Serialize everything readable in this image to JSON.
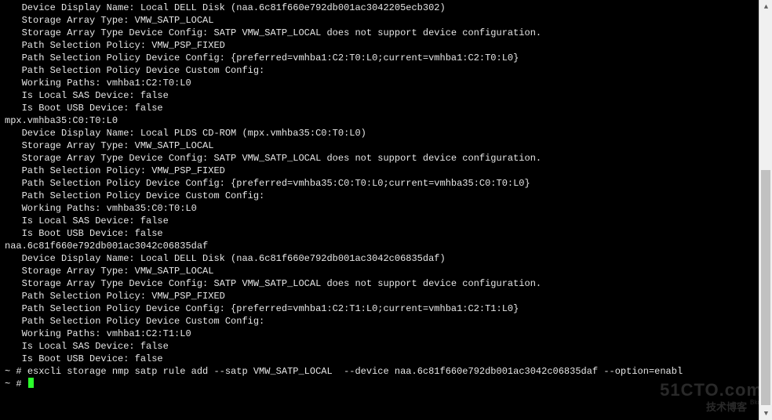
{
  "blocks": [
    {
      "header": null,
      "fields": [
        {
          "label": "Device Display Name",
          "value": "Local DELL Disk (naa.6c81f660e792db001ac3042205ecb302)"
        },
        {
          "label": "Storage Array Type",
          "value": "VMW_SATP_LOCAL"
        },
        {
          "label": "Storage Array Type Device Config",
          "value": "SATP VMW_SATP_LOCAL does not support device configuration."
        },
        {
          "label": "Path Selection Policy",
          "value": "VMW_PSP_FIXED"
        },
        {
          "label": "Path Selection Policy Device Config",
          "value": "{preferred=vmhba1:C2:T0:L0;current=vmhba1:C2:T0:L0}"
        },
        {
          "label": "Path Selection Policy Device Custom Config",
          "value": ""
        },
        {
          "label": "Working Paths",
          "value": "vmhba1:C2:T0:L0"
        },
        {
          "label": "Is Local SAS Device",
          "value": "false"
        },
        {
          "label": "Is Boot USB Device",
          "value": "false"
        }
      ]
    },
    {
      "header": "mpx.vmhba35:C0:T0:L0",
      "fields": [
        {
          "label": "Device Display Name",
          "value": "Local PLDS CD-ROM (mpx.vmhba35:C0:T0:L0)"
        },
        {
          "label": "Storage Array Type",
          "value": "VMW_SATP_LOCAL"
        },
        {
          "label": "Storage Array Type Device Config",
          "value": "SATP VMW_SATP_LOCAL does not support device configuration."
        },
        {
          "label": "Path Selection Policy",
          "value": "VMW_PSP_FIXED"
        },
        {
          "label": "Path Selection Policy Device Config",
          "value": "{preferred=vmhba35:C0:T0:L0;current=vmhba35:C0:T0:L0}"
        },
        {
          "label": "Path Selection Policy Device Custom Config",
          "value": ""
        },
        {
          "label": "Working Paths",
          "value": "vmhba35:C0:T0:L0"
        },
        {
          "label": "Is Local SAS Device",
          "value": "false"
        },
        {
          "label": "Is Boot USB Device",
          "value": "false"
        }
      ]
    },
    {
      "header": "naa.6c81f660e792db001ac3042c06835daf",
      "fields": [
        {
          "label": "Device Display Name",
          "value": "Local DELL Disk (naa.6c81f660e792db001ac3042c06835daf)"
        },
        {
          "label": "Storage Array Type",
          "value": "VMW_SATP_LOCAL"
        },
        {
          "label": "Storage Array Type Device Config",
          "value": "SATP VMW_SATP_LOCAL does not support device configuration."
        },
        {
          "label": "Path Selection Policy",
          "value": "VMW_PSP_FIXED"
        },
        {
          "label": "Path Selection Policy Device Config",
          "value": "{preferred=vmhba1:C2:T1:L0;current=vmhba1:C2:T1:L0}"
        },
        {
          "label": "Path Selection Policy Device Custom Config",
          "value": ""
        },
        {
          "label": "Working Paths",
          "value": "vmhba1:C2:T1:L0"
        },
        {
          "label": "Is Local SAS Device",
          "value": "false"
        },
        {
          "label": "Is Boot USB Device",
          "value": "false"
        }
      ]
    }
  ],
  "prompt1": {
    "symbol": "~ #",
    "command": "esxcli storage nmp satp rule add --satp VMW_SATP_LOCAL  --device naa.6c81f660e792db001ac3042c06835daf --option=enabl"
  },
  "prompt2": {
    "symbol": "~ #",
    "command": ""
  },
  "watermark": {
    "top": "51CTO.com",
    "bot": "技术博客",
    "blog": "Blog"
  }
}
